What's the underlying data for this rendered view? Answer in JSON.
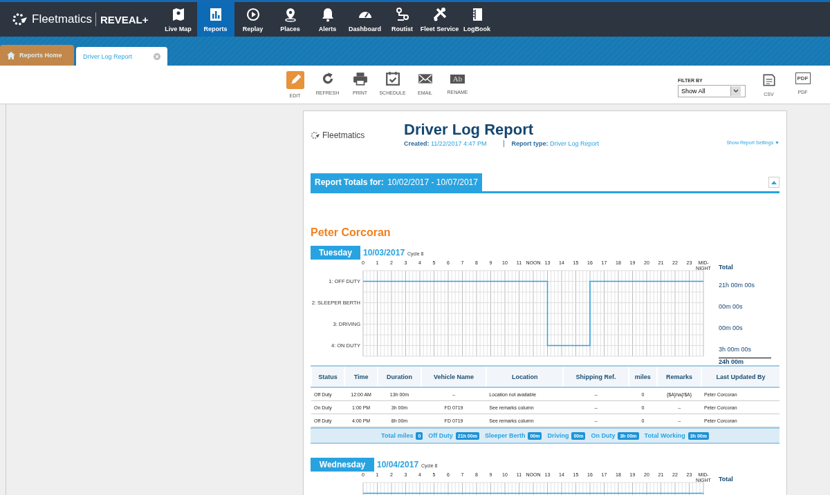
{
  "brand": {
    "name": "Fleetmatics",
    "product": "REVEAL+"
  },
  "nav": [
    {
      "label": "Live Map",
      "selected": false
    },
    {
      "label": "Reports",
      "selected": true
    },
    {
      "label": "Replay",
      "selected": false
    },
    {
      "label": "Places",
      "selected": false
    },
    {
      "label": "Alerts",
      "selected": false
    },
    {
      "label": "Dashboard",
      "selected": false
    },
    {
      "label": "Routist",
      "selected": false
    },
    {
      "label": "Fleet Service",
      "selected": false
    },
    {
      "label": "LogBook",
      "selected": false
    }
  ],
  "tabs": [
    {
      "label": "Reports Home",
      "kind": "home",
      "selected": false
    },
    {
      "label": "Driver Log Report",
      "kind": "doc",
      "selected": true
    }
  ],
  "toolbar": [
    {
      "label": "EDIT"
    },
    {
      "label": "REFRESH"
    },
    {
      "label": "PRINT"
    },
    {
      "label": "SCHEDULE"
    },
    {
      "label": "EMAIL"
    },
    {
      "label": "RENAME",
      "glyph": "Ab"
    }
  ],
  "filter": {
    "label": "FILTER BY",
    "value": "Show All"
  },
  "exports": [
    {
      "label": "CSV"
    },
    {
      "label": "PDF",
      "glyph": "PDF"
    }
  ],
  "report": {
    "logo": "Fleetmatics",
    "title": "Driver Log Report",
    "created_label": "Created:",
    "created": "11/22/2017 4:47 PM",
    "type_label": "Report type:",
    "type": "Driver Log Report",
    "settings_link": "Show Report Settings ▼",
    "totals_label": "Report Totals for:",
    "totals_range": "10/02/2017 - 10/07/2017",
    "driver": "Peter Corcoran",
    "days": [
      {
        "day": "Tuesday",
        "date": "10/03/2017",
        "cycle": "Cycle 8",
        "total_label": "Total",
        "totals": [
          "21h 00m 00s",
          "00m 00s",
          "00m 00s",
          "3h 00m 00s"
        ],
        "grand_total": "24h 00m",
        "chart_data": {
          "type": "line",
          "x": [
            0,
            13,
            13,
            16,
            16,
            24
          ],
          "series": [
            {
              "color": "#29a3e0",
              "values": [
                1,
                1,
                4,
                4,
                1,
                1
              ]
            }
          ],
          "xlim": [
            0,
            24
          ],
          "ylim": [
            4.5,
            0.5
          ],
          "grid": true,
          "xticks": [
            {
              "value": 0,
              "label": "0"
            },
            {
              "value": 1,
              "label": "1"
            },
            {
              "value": 2,
              "label": "2"
            },
            {
              "value": 3,
              "label": "3"
            },
            {
              "value": 4,
              "label": "4"
            },
            {
              "value": 5,
              "label": "5"
            },
            {
              "value": 6,
              "label": "6"
            },
            {
              "value": 7,
              "label": "7"
            },
            {
              "value": 8,
              "label": "8"
            },
            {
              "value": 9,
              "label": "9"
            },
            {
              "value": 10,
              "label": "10"
            },
            {
              "value": 11,
              "label": "11"
            },
            {
              "value": 12,
              "label": "NOON"
            },
            {
              "value": 13,
              "label": "13"
            },
            {
              "value": 14,
              "label": "14"
            },
            {
              "value": 15,
              "label": "15"
            },
            {
              "value": 16,
              "label": "16"
            },
            {
              "value": 17,
              "label": "17"
            },
            {
              "value": 18,
              "label": "18"
            },
            {
              "value": 19,
              "label": "19"
            },
            {
              "value": 20,
              "label": "20"
            },
            {
              "value": 21,
              "label": "21"
            },
            {
              "value": 22,
              "label": "22"
            },
            {
              "value": 23,
              "label": "23"
            },
            {
              "value": 24,
              "label": "MID-NIGHT"
            }
          ],
          "yticks": [
            {
              "value": 1,
              "label": "1: OFF DUTY"
            },
            {
              "value": 2,
              "label": "2: SLEEPER BERTH"
            },
            {
              "value": 3,
              "label": "3: DRIVING"
            },
            {
              "value": 4,
              "label": "4: ON DUTY"
            }
          ]
        },
        "table": {
          "columns": [
            "Status",
            "Time",
            "Duration",
            "Vehicle Name",
            "Location",
            "Shipping Ref.",
            "miles",
            "Remarks",
            "Last Updated By"
          ],
          "rows": [
            [
              "Off Duty",
              "12:00 AM",
              "13h 00m",
              "--",
              "Location not available",
              "--",
              "0",
              "{$A}ha{/$A}",
              "Peter Corcoran"
            ],
            [
              "On Duty",
              "1:00 PM",
              "3h 00m",
              "FD 0719",
              "See remarks column",
              "--",
              "0",
              "--",
              "Peter Corcoran"
            ],
            [
              "Off Duty",
              "4:00 PM",
              "8h 00m",
              "FD 0719",
              "See remarks column",
              "--",
              "0",
              "--",
              "Peter Corcoran"
            ]
          ],
          "summary": [
            {
              "label": "Total miles",
              "value": "0"
            },
            {
              "label": "Off Duty",
              "value": "21h 00m"
            },
            {
              "label": "Sleeper Berth",
              "value": "00m"
            },
            {
              "label": "Driving",
              "value": "00m"
            },
            {
              "label": "On Duty",
              "value": "3h 00m"
            },
            {
              "label": "Total Working",
              "value": "3h 00m"
            }
          ]
        }
      },
      {
        "day": "Wednesday",
        "date": "10/04/2017",
        "cycle": "Cycle 8",
        "total_label": "Total",
        "hour_labels": [
          "0",
          "1",
          "2",
          "3",
          "4",
          "5",
          "6",
          "7",
          "8",
          "9",
          "10",
          "11",
          "NOON",
          "13",
          "14",
          "15",
          "16",
          "17",
          "18",
          "19",
          "20",
          "21",
          "22",
          "23",
          "MID-NIGHT"
        ]
      }
    ]
  }
}
